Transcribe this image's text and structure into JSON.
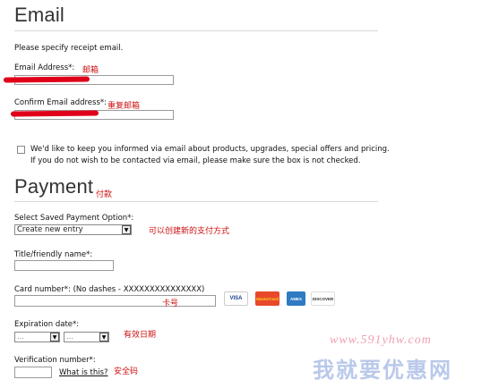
{
  "email_section": {
    "title": "Email",
    "instructions": "Please specify receipt email.",
    "email_label": "Email Address*:",
    "email_annotation": "邮箱",
    "confirm_label": "Confirm Email address*:",
    "confirm_annotation": "重复邮箱",
    "optin_text_line1": "We'd like to keep you informed via email about products, upgrades, special offers and pricing.",
    "optin_text_line2": "If you do not wish to be contacted via email, please make sure the box is not checked."
  },
  "payment_section": {
    "title": "Payment",
    "title_annotation": "付款",
    "saved_option_label": "Select Saved Payment Option*:",
    "saved_option_value": "Create new entry",
    "saved_option_annotation": "可以创建新的支付方式",
    "friendly_name_label": "Title/friendly name*:",
    "card_number_label": "Card number*: (No dashes - XXXXXXXXXXXXXXX)",
    "card_number_annotation": "卡号",
    "card_logos": {
      "visa": "VISA",
      "mastercard": "MasterCard",
      "amex": "AMEX",
      "discover": "DISCOVER"
    },
    "expiration_label": "Expiration date*:",
    "expiration_month_value": "...",
    "expiration_year_value": "...",
    "expiration_annotation": "有效日期",
    "verification_label": "Verification number*:",
    "verification_link": "What is this?",
    "verification_annotation": "安全码"
  },
  "watermark": {
    "url": "www.591yhw.com",
    "name": "我就要优惠网"
  },
  "colors": {
    "annotation_red": "#cc1111",
    "redaction_red": "#e0001a",
    "watermark_blue": "#b9c9ea",
    "watermark_pink": "#f0a0b0"
  }
}
